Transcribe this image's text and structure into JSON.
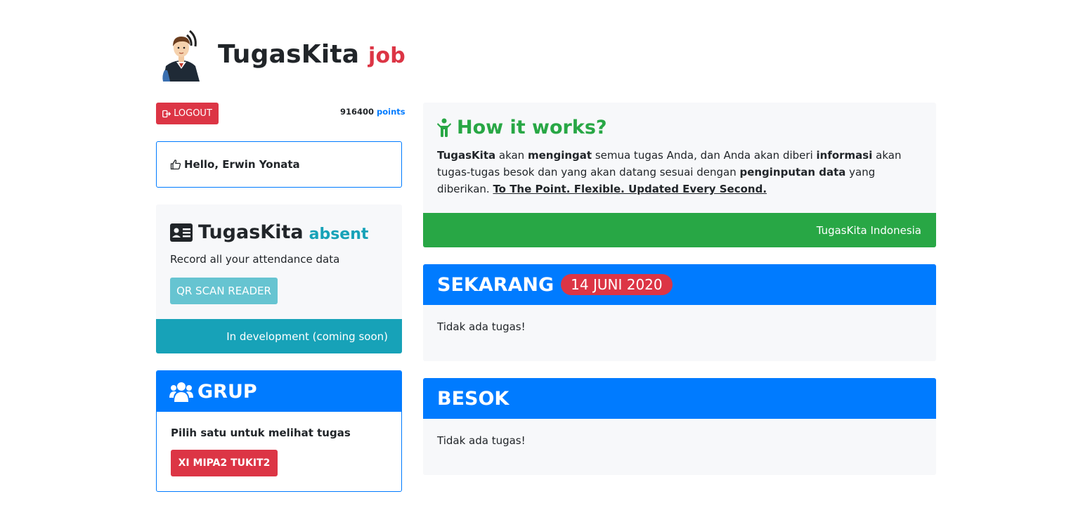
{
  "brand": {
    "title": "TugasKita",
    "accent": "job"
  },
  "topbar": {
    "logout_label": "LOGOUT",
    "points_value": "916400",
    "points_label": "points"
  },
  "hello": {
    "text": "Hello, Erwin Yonata"
  },
  "absent": {
    "title": "TugasKita",
    "accent": "absent",
    "description": "Record all your attendance data",
    "button_label": "QR SCAN READER",
    "footer": "In development (coming soon)"
  },
  "grup": {
    "title": "GRUP",
    "description": "Pilih satu untuk melihat tugas",
    "button_label": "XI MIPA2 TUKIT2"
  },
  "how": {
    "title": "How it works?",
    "text_parts": [
      "TugasKita",
      " akan ",
      "mengingat",
      " semua tugas Anda, dan Anda akan diberi ",
      "informasi",
      " akan tugas-tugas besok dan yang akan datang sesuai dengan ",
      "penginputan data",
      " yang diberikan. ",
      "To The Point. Flexible. Updated Every Second."
    ],
    "footer": "TugasKita Indonesia"
  },
  "today": {
    "title": "SEKARANG",
    "date_badge": "14 JUNI 2020",
    "body": "Tidak ada tugas!"
  },
  "tomorrow": {
    "title": "BESOK",
    "body": "Tidak ada tugas!"
  },
  "colors": {
    "red": "#dc3545",
    "blue": "#007bff",
    "green": "#28a745",
    "teal": "#17a2b8",
    "light_teal": "#66c4d1",
    "panel_bg": "#f7f8fa"
  },
  "icons": [
    "avatar-logo",
    "sign-out-icon",
    "thumbs-up-icon",
    "id-card-icon",
    "users-icon",
    "child-icon"
  ]
}
